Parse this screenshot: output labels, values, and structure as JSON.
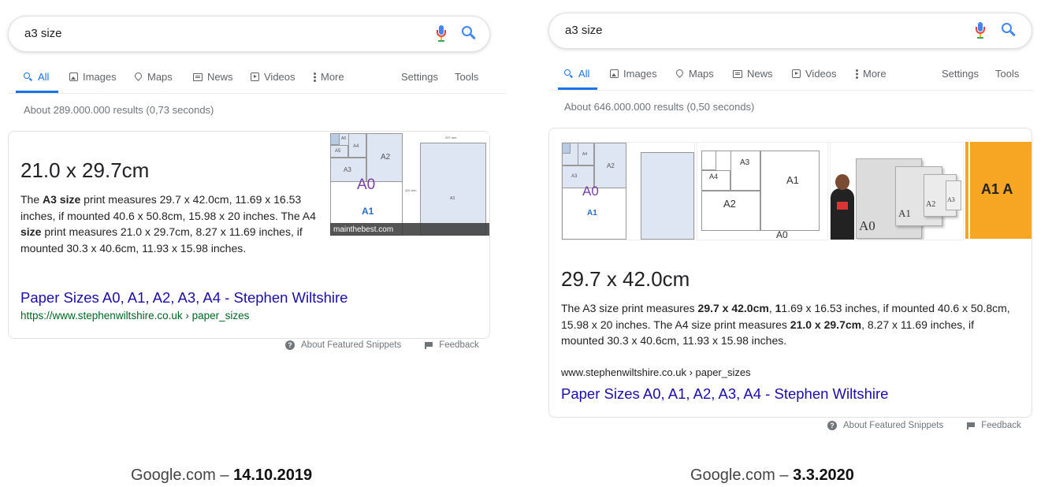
{
  "left": {
    "search": {
      "query": "a3 size"
    },
    "tabs": [
      {
        "label": "All",
        "icon": "search-icon"
      },
      {
        "label": "Images",
        "icon": "image-icon"
      },
      {
        "label": "Maps",
        "icon": "map-icon"
      },
      {
        "label": "News",
        "icon": "news-icon"
      },
      {
        "label": "Videos",
        "icon": "video-icon"
      },
      {
        "label": "More",
        "icon": "more-vert-icon"
      }
    ],
    "settings": "Settings",
    "tools": "Tools",
    "stats": "About 289.000.000 results (0,73 seconds)",
    "answer": "21.0 x 29.7cm",
    "snippet": {
      "p1": "The ",
      "b1": "A3 size",
      "p2": " print measures 29.7 x 42.0cm, 11.69 x 16.53 inches, if mounted 40.6 x 50.8cm, 15.98 x 20 inches. The A4 ",
      "b2": "size",
      "p3": " print measures 21.0 x 29.7cm, 8.27 x 11.69 inches, if mounted 30.3 x 40.6cm, 11.93 x 15.98 inches."
    },
    "image": {
      "source": "mainthebest.com",
      "labels": {
        "a0": "A0",
        "a1": "A1",
        "a2": "A2",
        "a3": "A3",
        "a4": "A4",
        "a5": "A5",
        "a6": "A6",
        "a3big": "A3",
        "top_dim": "297 mm",
        "side_dim": "420 mm"
      }
    },
    "result_title": "Paper Sizes A0, A1, A2, A3, A4 - Stephen Wiltshire",
    "result_url": "https://www.stephenwiltshire.co.uk › paper_sizes",
    "about_snippets": "About Featured Snippets",
    "feedback": "Feedback",
    "caption_prefix": "Google.com – ",
    "caption_date": "14.10.2019"
  },
  "right": {
    "search": {
      "query": "a3 size"
    },
    "tabs": [
      {
        "label": "All",
        "icon": "search-icon"
      },
      {
        "label": "Images",
        "icon": "image-icon"
      },
      {
        "label": "Maps",
        "icon": "map-pin-icon"
      },
      {
        "label": "News",
        "icon": "news-icon"
      },
      {
        "label": "Videos",
        "icon": "video-icon"
      },
      {
        "label": "More",
        "icon": "more-vert-icon"
      }
    ],
    "settings": "Settings",
    "tools": "Tools",
    "stats": "About 646.000.000 results (0,50 seconds)",
    "images": {
      "t1": {
        "a0": "A0",
        "a1": "A1",
        "a2": "A2",
        "a3": "A3",
        "a4": "A4"
      },
      "t2": {
        "a0": "A0",
        "a1": "A1",
        "a2": "A2",
        "a3": "A3",
        "a4": "A4"
      },
      "t3": {
        "a0": "A0",
        "a1": "A1",
        "a2": "A2",
        "a3": "A3"
      },
      "t4": {
        "text": "A1 A"
      }
    },
    "answer": "29.7 x 42.0cm",
    "snippet": {
      "p1": "The A3 size print measures ",
      "b1": "29.7 x 42.0cm",
      "p2": ", ",
      "b2": "1",
      "p3": "1.69 x 16.53 inches, if mounted 40.6 x 50.8cm, 15.98 x 20 inches. The A4 size print measures ",
      "b3": "21.0 x 29.7cm",
      "p4": ", 8.27 x 11.69 inches, if mounted 30.3 x 40.6cm, 11.93 x 15.98 inches."
    },
    "result_url": "www.stephenwiltshire.co.uk › paper_sizes",
    "result_title": "Paper Sizes A0, A1, A2, A3, A4 - Stephen Wiltshire",
    "about_snippets": "About Featured Snippets",
    "feedback": "Feedback",
    "caption_prefix": "Google.com – ",
    "caption_date": "3.3.2020"
  },
  "colors": {
    "link": "#1a0dab",
    "url_green": "#006621",
    "accent": "#1a73e8",
    "a0_purple": "#7b3fa6",
    "a1_blue": "#2a6cc7",
    "thumb_orange": "#f6a623"
  }
}
